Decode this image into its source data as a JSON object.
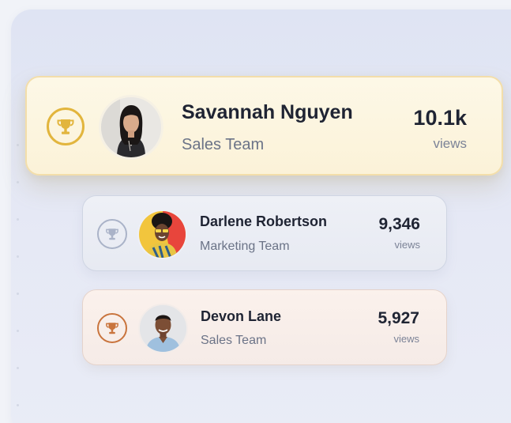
{
  "leaderboard": {
    "entries": [
      {
        "rank": 1,
        "name": "Savannah Nguyen",
        "team": "Sales Team",
        "views": "10.1k",
        "views_label": "views",
        "trophy_color": "#e2b53d"
      },
      {
        "rank": 2,
        "name": "Darlene Robertson",
        "team": "Marketing Team",
        "views": "9,346",
        "views_label": "views",
        "trophy_color": "#aab3c8"
      },
      {
        "rank": 3,
        "name": "Devon Lane",
        "team": "Sales Team",
        "views": "5,927",
        "views_label": "views",
        "trophy_color": "#c9743d"
      }
    ]
  },
  "colors": {
    "gold": "#e2b53d",
    "silver": "#aab3c8",
    "bronze": "#c9743d",
    "text_primary": "#1f2433",
    "text_secondary": "#6b7387"
  }
}
